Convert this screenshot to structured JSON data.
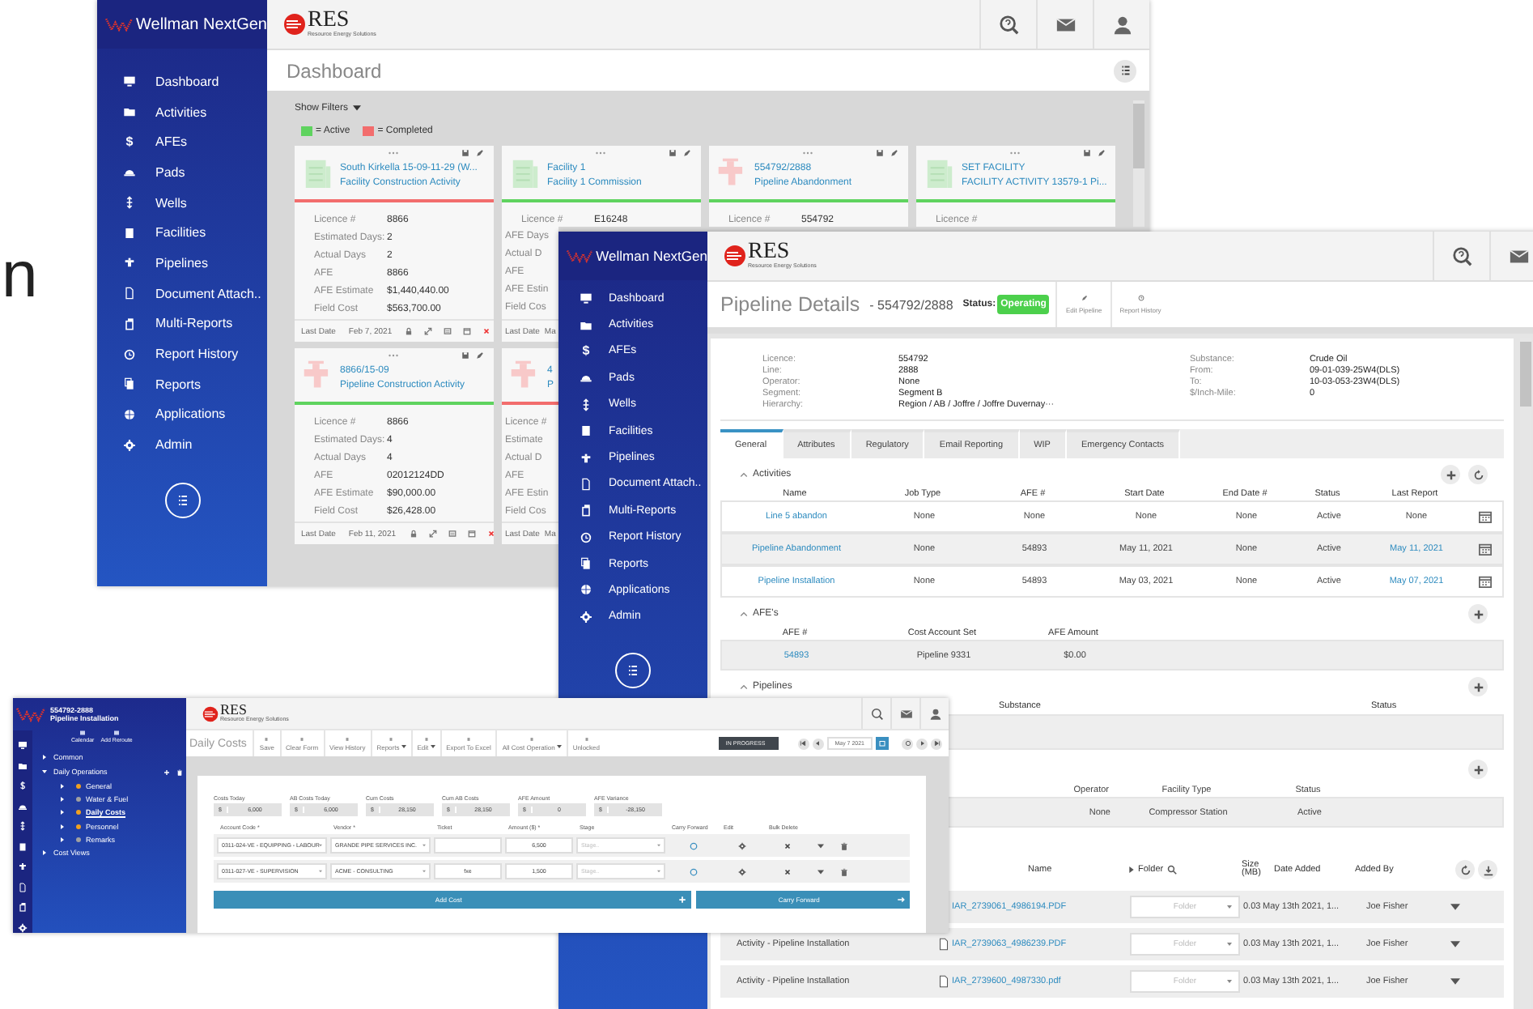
{
  "edge_text": "n",
  "dashboard_window": {
    "brand": "Wellman NextGen",
    "logo_text": "RES",
    "logo_tagline": "Resource Energy Solutions",
    "sidebar": [
      {
        "label": "Dashboard"
      },
      {
        "label": "Activities"
      },
      {
        "label": "AFEs",
        "glyph": "$"
      },
      {
        "label": "Pads"
      },
      {
        "label": "Wells"
      },
      {
        "label": "Facilities"
      },
      {
        "label": "Pipelines"
      },
      {
        "label": "Document Attach.."
      },
      {
        "label": "Multi-Reports"
      },
      {
        "label": "Report History"
      },
      {
        "label": "Reports"
      },
      {
        "label": "Applications"
      },
      {
        "label": "Admin"
      }
    ],
    "page_title": "Dashboard",
    "show_filters": "Show Filters",
    "legend": [
      {
        "label": "= Active",
        "color": "#5fd35f"
      },
      {
        "label": "= Completed",
        "color": "#f26d6d"
      }
    ],
    "cards": [
      {
        "kind": "facility",
        "color": "#f26d6d",
        "title": "South Kirkella 15-09-11-29 (W...",
        "subtitle": "Facility Construction Activity",
        "fields": [
          {
            "label": "Licence #",
            "value": "8866"
          },
          {
            "label": "Estimated Days:",
            "value": "2"
          },
          {
            "label": "Actual Days",
            "value": "2"
          },
          {
            "label": "AFE",
            "value": "8866"
          },
          {
            "label": "AFE Estimate",
            "value": "$1,440,440.00"
          },
          {
            "label": "Field Cost",
            "value": "$563,700.00"
          }
        ],
        "footer": {
          "label": "Last Date",
          "value": "Feb 7, 2021",
          "actions": true
        }
      },
      {
        "kind": "facility",
        "color": "#5fd35f",
        "title": "Facility 1",
        "subtitle": "Facility 1 Commission",
        "fields": [
          {
            "label": "Licence #",
            "value": "E16248"
          },
          {
            "label": "AFE Days"
          },
          {
            "label": "Actual D"
          },
          {
            "label": "AFE"
          },
          {
            "label": "AFE Estin"
          },
          {
            "label": "Field Cos"
          }
        ],
        "footer": {
          "label": "Last Date",
          "value": "Ma"
        }
      },
      {
        "kind": "pipeline",
        "color": "#5fd35f",
        "title": "554792/2888",
        "subtitle": "Pipeline Abandonment",
        "fields": [
          {
            "label": "Licence #",
            "value": "554792"
          }
        ]
      },
      {
        "kind": "facility",
        "color": "#5fd35f",
        "title": "SET FACILITY",
        "subtitle": "FACILITY ACTIVITY 13579-1 Pi...",
        "fields": [
          {
            "label": "Licence #"
          }
        ]
      },
      {
        "kind": "pipeline",
        "color": "#5fd35f",
        "title": "8866/15-09",
        "subtitle": "Pipeline Construction Activity",
        "fields": [
          {
            "label": "Licence #",
            "value": "8866"
          },
          {
            "label": "Estimated Days:",
            "value": "4"
          },
          {
            "label": "Actual Days",
            "value": "4"
          },
          {
            "label": "AFE",
            "value": "02012124DD"
          },
          {
            "label": "AFE Estimate",
            "value": "$90,000.00"
          },
          {
            "label": "Field Cost",
            "value": "$26,428.00"
          }
        ],
        "footer": {
          "label": "Last Date",
          "value": "Feb 11, 2021",
          "actions": true
        }
      },
      {
        "kind": "pipeline",
        "color": "#f26d6d",
        "title": "4",
        "subtitle": "P",
        "fields": [
          {
            "label": "Licence #"
          },
          {
            "label": "Estimate"
          },
          {
            "label": "Actual D"
          },
          {
            "label": "AFE"
          },
          {
            "label": "AFE Estin"
          },
          {
            "label": "Field Cos"
          }
        ],
        "footer": {
          "label": "Last Date",
          "value": "Ma"
        }
      }
    ]
  },
  "pipeline_window": {
    "brand": "Wellman NextGen",
    "logo_text": "RES",
    "logo_tagline": "Resource Energy Solutions",
    "sidebar": [
      {
        "label": "Dashboard"
      },
      {
        "label": "Activities"
      },
      {
        "label": "AFEs",
        "glyph": "$"
      },
      {
        "label": "Pads"
      },
      {
        "label": "Wells"
      },
      {
        "label": "Facilities"
      },
      {
        "label": "Pipelines"
      },
      {
        "label": "Document Attach.."
      },
      {
        "label": "Multi-Reports"
      },
      {
        "label": "Report History"
      },
      {
        "label": "Reports"
      },
      {
        "label": "Applications"
      },
      {
        "label": "Admin"
      }
    ],
    "title": "Pipeline Details",
    "record": "- 554792/2888",
    "status_label": "Status:",
    "status": "Operating",
    "toolbar": [
      "Edit Pipeline",
      "Report History"
    ],
    "info_left": [
      {
        "label": "Licence:",
        "value": "554792"
      },
      {
        "label": "Line:",
        "value": "2888"
      },
      {
        "label": "Operator:",
        "value": "None"
      },
      {
        "label": "Segment:",
        "value": "Segment B"
      },
      {
        "label": "Hierarchy:",
        "value": "Region / AB / Joffre / Joffre Duvernay···"
      }
    ],
    "info_right": [
      {
        "label": "Substance:",
        "value": "Crude Oil"
      },
      {
        "label": "From:",
        "value": "09-01-039-25W4(DLS)"
      },
      {
        "label": "To:",
        "value": "10-03-053-23W4(DLS)"
      },
      {
        "label": "$/Inch-Mile:",
        "value": "0"
      }
    ],
    "tabs": [
      {
        "label": "General",
        "selected": true
      },
      {
        "label": "Attributes",
        "selected": false
      },
      {
        "label": "Regulatory",
        "selected": false
      },
      {
        "label": "Email Reporting",
        "selected": false
      },
      {
        "label": "WIP",
        "selected": false
      },
      {
        "label": "Emergency Contacts",
        "selected": false
      }
    ],
    "activities": {
      "title": "Activities",
      "columns": [
        "Name",
        "Job Type",
        "AFE #",
        "Start Date",
        "End Date #",
        "Status",
        "Last Report"
      ],
      "rows": [
        {
          "name": "Line 5 abandon",
          "job_type": "None",
          "afe": "None",
          "start": "None",
          "end": "None",
          "status": "Active",
          "last_report": {
            "text": "None",
            "link": false
          }
        },
        {
          "name": "Pipeline Abandonment",
          "job_type": "None",
          "afe": "54893",
          "start": "May 11, 2021",
          "end": "None",
          "status": "Active",
          "last_report": {
            "text": "May 11, 2021",
            "link": true
          }
        },
        {
          "name": "Pipeline Installation",
          "job_type": "None",
          "afe": "54893",
          "start": "May 03, 2021",
          "end": "None",
          "status": "Active",
          "last_report": {
            "text": "May 07, 2021",
            "link": true
          }
        }
      ]
    },
    "afes": {
      "title": "AFE's",
      "columns": [
        "AFE #",
        "Cost Account Set",
        "AFE Amount"
      ],
      "rows": [
        {
          "afe": "54893",
          "set": "Pipeline 9331",
          "amount": "$0.00"
        }
      ]
    },
    "pipelines": {
      "title": "Pipelines",
      "columns": [
        "Substance",
        "Status"
      ]
    },
    "facilities": {
      "columns": [
        "Operator",
        "Facility Type",
        "Status"
      ],
      "rows": [
        [
          "None",
          "Compressor Station",
          "Active"
        ]
      ]
    },
    "documents": {
      "columns": [
        "Name",
        "Folder",
        "Size (MB)",
        "Date Added",
        "Added By"
      ],
      "rows": [
        {
          "file": "IAR_2739061_4986194.PDF",
          "folder": "Folder",
          "size": "0.03",
          "date": "May 13th 2021, 1...",
          "added_by": "Joe Fisher"
        },
        {
          "source": "Activity - Pipeline Installation",
          "file": "IAR_2739063_4986239.PDF",
          "folder": "Folder",
          "size": "0.03",
          "date": "May 13th 2021, 1...",
          "added_by": "Joe Fisher"
        },
        {
          "source": "Activity - Pipeline Installation",
          "file": "IAR_2739600_4987330.pdf",
          "folder": "Folder",
          "size": "0.03",
          "date": "May 13th 2021, 1...",
          "added_by": "Joe Fisher"
        }
      ]
    }
  },
  "costs_window": {
    "record": "554792-2888",
    "record_title": "Pipeline Installation",
    "logo_text": "RES",
    "logo_tagline": "Resource Energy Solutions",
    "side_tools": [
      "Calendar",
      "Add Reroute"
    ],
    "tree": [
      {
        "label": "Common",
        "expanded": false
      },
      {
        "label": "Daily Operations",
        "expanded": true,
        "children": [
          {
            "label": "General",
            "color": "#f0a020",
            "selected": false
          },
          {
            "label": "Water & Fuel",
            "color": "#a0a0a0",
            "selected": false
          },
          {
            "label": "Daily Costs",
            "color": "#f0a020",
            "selected": true
          },
          {
            "label": "Personnel",
            "color": "#f0a020",
            "selected": false
          },
          {
            "label": "Remarks",
            "color": "#a0a0a0",
            "selected": false
          }
        ]
      },
      {
        "label": "Cost Views",
        "expanded": false
      }
    ],
    "title": "Daily Costs",
    "toolbar": [
      {
        "label": "Save",
        "caret": false
      },
      {
        "label": "Clear Form",
        "caret": false
      },
      {
        "label": "View History",
        "caret": false
      },
      {
        "label": "Reports",
        "caret": true
      },
      {
        "label": "Edit",
        "caret": true
      },
      {
        "label": "Export To Excel",
        "caret": false
      },
      {
        "label": "All Cost Operation",
        "caret": true
      },
      {
        "label": "Unlocked",
        "caret": false
      }
    ],
    "state": "IN PROGRESS",
    "date": "May 7 2021",
    "summary": [
      {
        "label": "Costs Today",
        "value": "6,000"
      },
      {
        "label": "AB Costs Today",
        "value": "6,000"
      },
      {
        "label": "Cum Costs",
        "value": "28,150"
      },
      {
        "label": "Cum AB Costs",
        "value": "28,150"
      },
      {
        "label": "AFE Amount",
        "value": "0"
      },
      {
        "label": "AFE Variance",
        "value": "-28,150"
      }
    ],
    "currency": "$",
    "columns": [
      "Account Code *",
      "Vendor *",
      "Ticket",
      "Amount ($) *",
      "Stage",
      "Carry Forward",
      "Edit",
      "Bulk Delete"
    ],
    "lines": [
      {
        "account": "0311-024-VE - EQUIPPING - LABOUR",
        "vendor": "GRANDE PIPE SERVICES INC.",
        "amount": "6,500",
        "stage": "Stage.."
      },
      {
        "account": "0311-027-VE - SUPERVISION",
        "vendor": "ACME - CONSULTING",
        "ticket": "fxe",
        "amount": "1,500",
        "stage": "Stage.."
      }
    ],
    "add_button": "Add Cost",
    "carry_button": "Carry Forward"
  }
}
